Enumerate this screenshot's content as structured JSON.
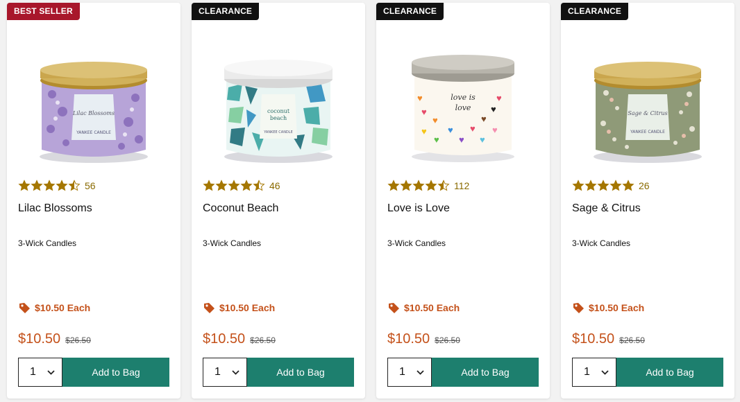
{
  "products": [
    {
      "badge": "BEST SELLER",
      "badge_type": "bestseller",
      "rating": 4.5,
      "reviews": "56",
      "name": "Lilac Blossoms",
      "category": "3-Wick Candles",
      "promo": "$10.50 Each",
      "price": "$10.50",
      "original_price": "$26.50",
      "quantity": "1",
      "add_label": "Add to Bag",
      "lid_color": "#c9a848",
      "jar_color": "#b7a4d8",
      "image_icon": "lilac-candle-image"
    },
    {
      "badge": "CLEARANCE",
      "badge_type": "clearance",
      "rating": 4.5,
      "reviews": "46",
      "name": "Coconut Beach",
      "category": "3-Wick Candles",
      "promo": "$10.50 Each",
      "price": "$10.50",
      "original_price": "$26.50",
      "quantity": "1",
      "add_label": "Add to Bag",
      "lid_color": "#f2f2f2",
      "jar_color": "#5bb5b2",
      "image_icon": "coconut-candle-image"
    },
    {
      "badge": "CLEARANCE",
      "badge_type": "clearance",
      "rating": 4.5,
      "reviews": "112",
      "name": "Love is Love",
      "category": "3-Wick Candles",
      "promo": "$10.50 Each",
      "price": "$10.50",
      "original_price": "$26.50",
      "quantity": "1",
      "add_label": "Add to Bag",
      "lid_color": "#b9b6ad",
      "jar_color": "#fbf7ef",
      "image_icon": "love-candle-image"
    },
    {
      "badge": "CLEARANCE",
      "badge_type": "clearance",
      "rating": 5,
      "reviews": "26",
      "name": "Sage & Citrus",
      "category": "3-Wick Candles",
      "promo": "$10.50 Each",
      "price": "$10.50",
      "original_price": "$26.50",
      "quantity": "1",
      "add_label": "Add to Bag",
      "lid_color": "#c9a848",
      "jar_color": "#8f9a78",
      "image_icon": "sage-candle-image"
    }
  ],
  "colors": {
    "star": "#a57700",
    "accent_orange": "#c4511a",
    "button_green": "#1d7f6e",
    "best_seller_red": "#a8172b"
  }
}
